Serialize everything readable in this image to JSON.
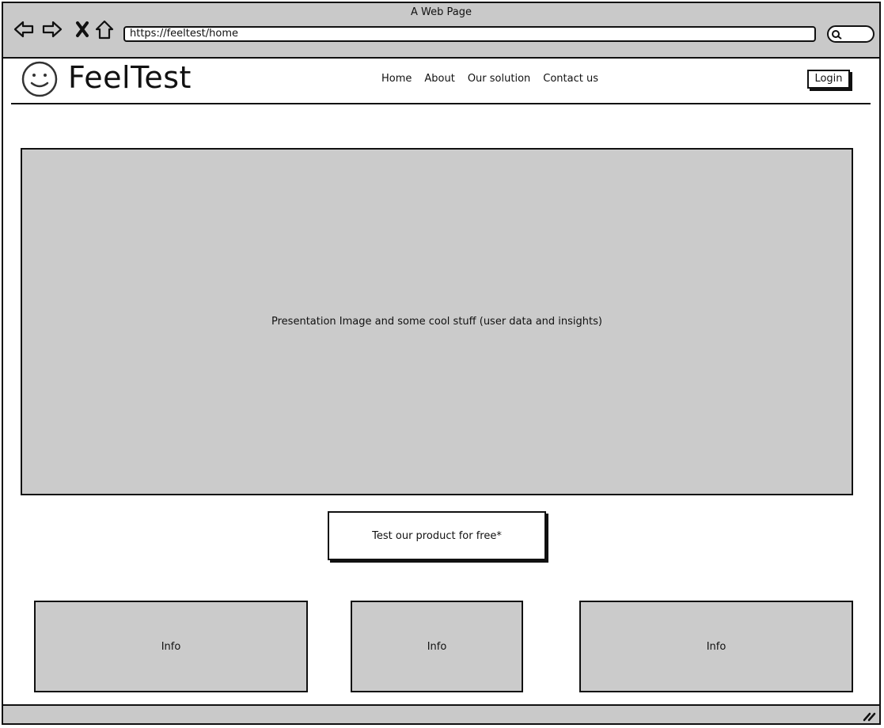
{
  "window": {
    "title": "A Web Page"
  },
  "browser": {
    "url": "https://feeltest/home",
    "icons": [
      "back-icon",
      "forward-icon",
      "close-icon",
      "home-icon",
      "search-icon"
    ]
  },
  "header": {
    "brand": "FeelTest",
    "nav": [
      "Home",
      "About",
      "Our solution",
      "Contact us"
    ],
    "login_label": "Login"
  },
  "hero": {
    "text": "Presentation Image and some cool stuff (user data and insights)"
  },
  "cta": {
    "label": "Test our product for free*"
  },
  "info_boxes": [
    "Info",
    "Info",
    "Info"
  ],
  "colors": {
    "chrome_gray": "#c9c9c9",
    "placeholder_gray": "#cbcbcb",
    "stroke": "#111111"
  }
}
